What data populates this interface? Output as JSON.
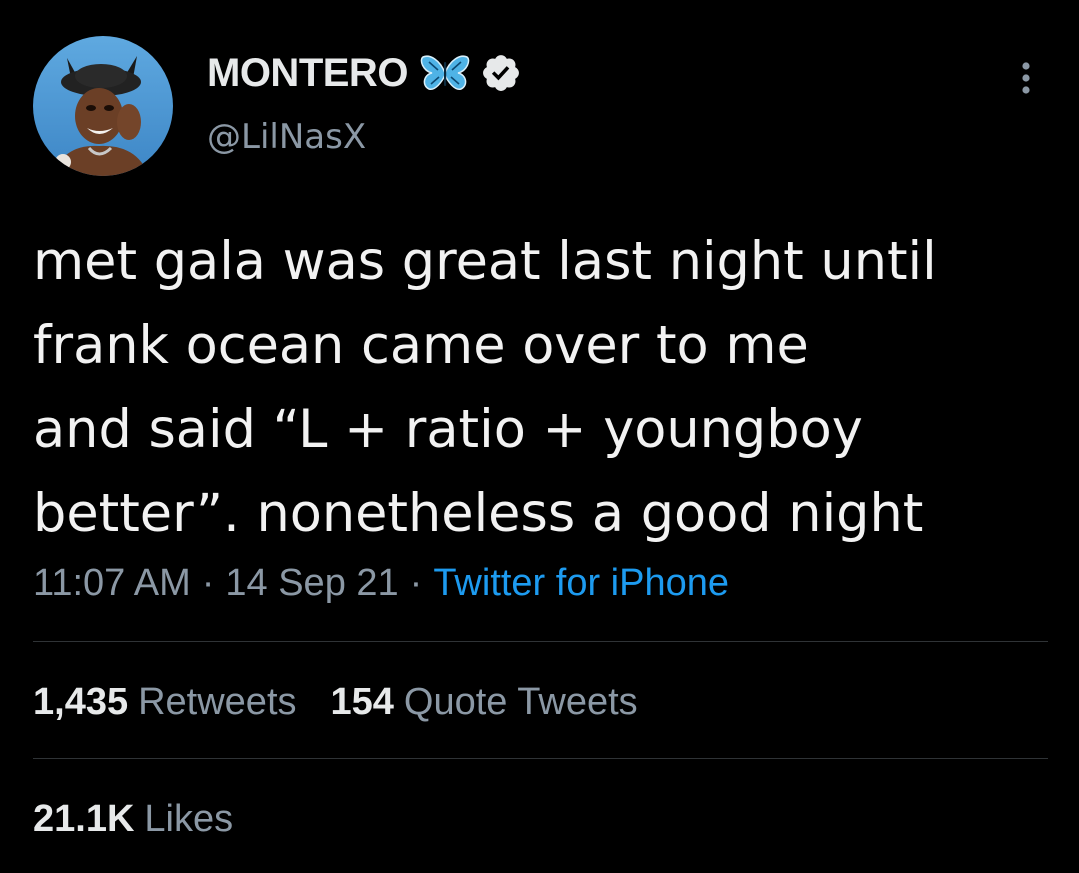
{
  "author": {
    "display_name": "MONTERO",
    "handle": "@LilNasX",
    "avatar_icon": "profile-photo",
    "name_emoji_icon": "blue-butterfly-icon",
    "verified_icon": "verified-badge-icon"
  },
  "tweet": {
    "text_lines": [
      "met gala was great last night until",
      "frank ocean came over to me",
      "and said “L + ratio + youngboy",
      "better”. nonetheless a good night"
    ],
    "time": "11:07 AM",
    "date": "14 Sep 21",
    "separator": "·",
    "source": "Twitter for iPhone"
  },
  "stats": {
    "retweets": {
      "count": "1,435",
      "label": "Retweets"
    },
    "quote_tweets": {
      "count": "154",
      "label": "Quote Tweets"
    },
    "likes": {
      "count": "21.1K",
      "label": "Likes"
    }
  },
  "colors": {
    "background": "#000000",
    "text_primary": "#e7e9ea",
    "text_secondary": "#8b98a5",
    "link": "#1d9bf0",
    "divider": "#2f3336",
    "butterfly": "#4fb3e6"
  }
}
